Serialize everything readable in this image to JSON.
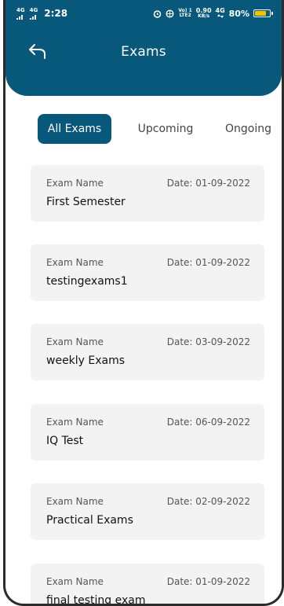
{
  "status_bar": {
    "network_left": "4G",
    "network_right": "4G",
    "time": "2:28",
    "vol_top": "Vo) 1",
    "vol_bottom": "LTE2",
    "speed_top": "0.90",
    "speed_bottom": "KB/s",
    "net_type": "4G",
    "battery": "80%",
    "battery_level": 0.8
  },
  "header": {
    "title": "Exams",
    "back_icon": "back-arrow-icon",
    "background": "#08587c"
  },
  "tabs": [
    {
      "label": "All Exams",
      "active": true
    },
    {
      "label": "Upcoming",
      "active": false
    },
    {
      "label": "Ongoing",
      "active": false
    }
  ],
  "exams": [
    {
      "label": "Exam Name",
      "date": "Date: 01-09-2022",
      "name": "First Semester"
    },
    {
      "label": "Exam Name",
      "date": "Date: 01-09-2022",
      "name": "testingexams1"
    },
    {
      "label": "Exam Name",
      "date": "Date: 03-09-2022",
      "name": "weekly Exams"
    },
    {
      "label": "Exam Name",
      "date": "Date: 06-09-2022",
      "name": "IQ Test"
    },
    {
      "label": "Exam Name",
      "date": "Date: 02-09-2022",
      "name": "Practical Exams"
    },
    {
      "label": "Exam Name",
      "date": "Date: 01-09-2022",
      "name": "final testing exam"
    }
  ]
}
